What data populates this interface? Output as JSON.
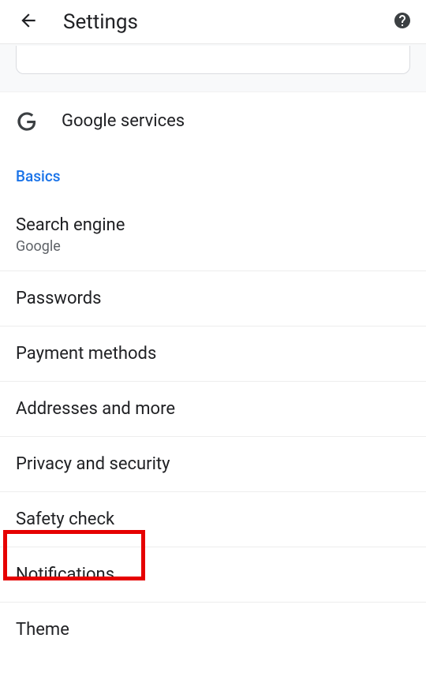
{
  "header": {
    "title": "Settings"
  },
  "googleServices": {
    "label": "Google services"
  },
  "sectionHeader": "Basics",
  "items": {
    "searchEngine": {
      "title": "Search engine",
      "sub": "Google"
    },
    "passwords": {
      "title": "Passwords"
    },
    "payment": {
      "title": "Payment methods"
    },
    "addresses": {
      "title": "Addresses and more"
    },
    "privacy": {
      "title": "Privacy and security"
    },
    "safety": {
      "title": "Safety check"
    },
    "notifications": {
      "title": "Notifications"
    },
    "theme": {
      "title": "Theme"
    }
  }
}
